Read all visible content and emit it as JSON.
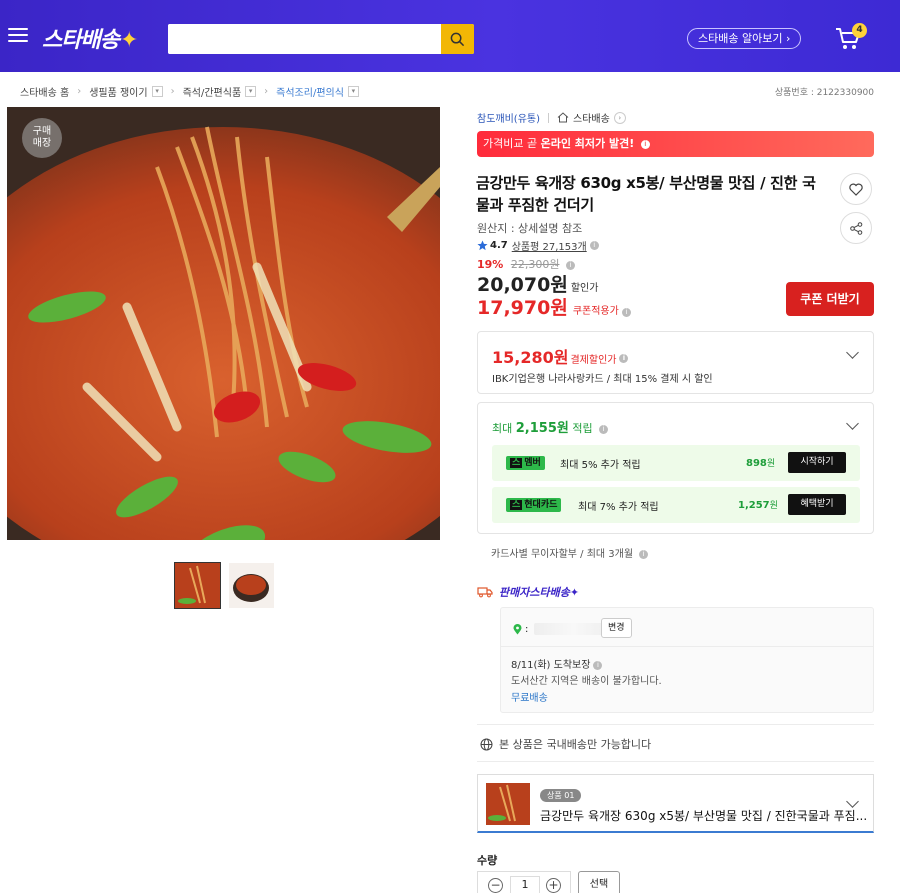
{
  "header": {
    "logo": "스타배송",
    "search_placeholder": "",
    "about_label": "스타배송 알아보기 ›",
    "cart_count": "4"
  },
  "breadcrumb": {
    "items": [
      "스타배송 홈",
      "생필품 쟁이기",
      "즉석/간편식품",
      "즉석조리/편의식"
    ],
    "product_no": "상품번호 : 2122330900"
  },
  "gallery": {
    "store_badge": "구매\n매장",
    "thumbnails": [
      "thumb-1",
      "thumb-2"
    ]
  },
  "product": {
    "seller": "참도깨비(유통)",
    "store": "스타배송",
    "banner_prefix": "가격비교 곧 ",
    "banner_bold": "온라인 최저가 발견!",
    "title": "금강만두 육개장 630g x5봉/ 부산명물 맛집 / 진한 국물과 푸짐한 건더기",
    "origin": "원산지 : 상세설명 참조",
    "rating": "4.7",
    "review_label": "상품평 27,153개",
    "discount_rate": "19%",
    "original_price": "22,300원",
    "sale_price": "20,070원",
    "sale_label": "할인가",
    "coupon_price": "17,970원",
    "coupon_label": "쿠폰적용가",
    "coupon_button": "쿠폰 더받기"
  },
  "payment": {
    "price": "15,280원",
    "label": "결제할인가",
    "desc": "IBK기업은행 나라사랑카드 / 최대 15% 결제 시 할인"
  },
  "rewards": {
    "title_prefix": "최대 ",
    "title_amount": "2,155원",
    "title_suffix": " 적립",
    "rows": [
      {
        "tag_k": "스",
        "tag": "멤버",
        "text": "최대 5% 추가 적립",
        "amount": "898",
        "unit": "원",
        "button": "시작하기"
      },
      {
        "tag_k": "스",
        "tag": "현대카드",
        "text": "최대 7% 추가 적립",
        "amount": "1,257",
        "unit": "원",
        "button": "혜택받기"
      }
    ],
    "installment": "카드사별 무이자할부 / 최대 3개월"
  },
  "delivery": {
    "label": "판매자",
    "seller": "스타배송",
    "change_label": "변경",
    "arrival": "8/11(화) 도착보장",
    "remote_notice": "도서산간 지역은 배송이 불가합니다.",
    "free_shipping": "무료배송",
    "domestic_notice": "본 상품은 국내배송만 가능합니다"
  },
  "option": {
    "badge": "상품 01",
    "name": "금강만두 육개장 630g x5봉/ 부산명물 맛집 / 진한국물과 푸짐..."
  },
  "quantity": {
    "label": "수량",
    "value": "1",
    "select_label": "선택"
  },
  "colors": {
    "brand": "#3b25c7",
    "accent_red": "#e52828",
    "search_button": "#f2b705",
    "reward_green": "#1e9e3a"
  },
  "icons": [
    "menu-icon",
    "search-icon",
    "cart-icon",
    "heart-icon",
    "share-icon",
    "star-icon",
    "home-icon",
    "truck-icon",
    "location-pin-icon",
    "globe-icon",
    "chevron-down-icon"
  ]
}
